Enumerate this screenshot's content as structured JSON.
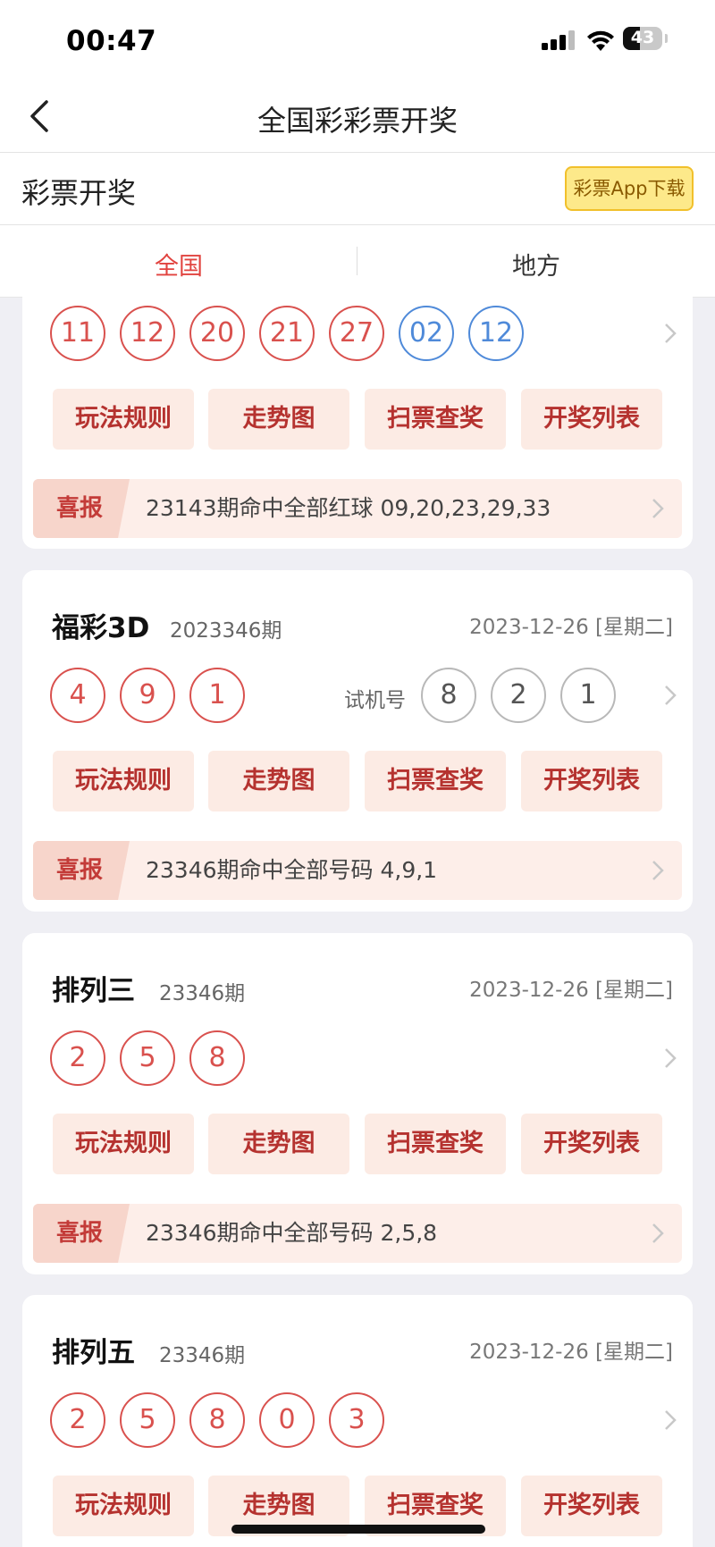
{
  "status": {
    "time": "00:47",
    "battery": "43"
  },
  "nav": {
    "title": "全国彩彩票开奖"
  },
  "subheader": {
    "title": "彩票开奖",
    "download_label": "彩票App下载"
  },
  "tabs": [
    {
      "label": "全国"
    },
    {
      "label": "地方"
    }
  ],
  "common": {
    "actions": [
      "玩法规则",
      "走势图",
      "扫票查奖",
      "开奖列表"
    ],
    "news_tag": "喜报",
    "trial_label": "试机号"
  },
  "cards": [
    {
      "red": [
        "11",
        "12",
        "20",
        "21",
        "27"
      ],
      "blue": [
        "02",
        "12"
      ],
      "news": "23143期命中全部红球 09,20,23,29,33"
    },
    {
      "title": "福彩3D",
      "issue": "2023346期",
      "date": "2023-12-26 [星期二]",
      "red": [
        "4",
        "9",
        "1"
      ],
      "trial": [
        "8",
        "2",
        "1"
      ],
      "news": "23346期命中全部号码 4,9,1"
    },
    {
      "title": "排列三",
      "issue": "23346期",
      "date": "2023-12-26 [星期二]",
      "red": [
        "2",
        "5",
        "8"
      ],
      "news": "23346期命中全部号码 2,5,8"
    },
    {
      "title": "排列五",
      "issue": "23346期",
      "date": "2023-12-26 [星期二]",
      "red": [
        "2",
        "5",
        "8",
        "0",
        "3"
      ]
    }
  ]
}
